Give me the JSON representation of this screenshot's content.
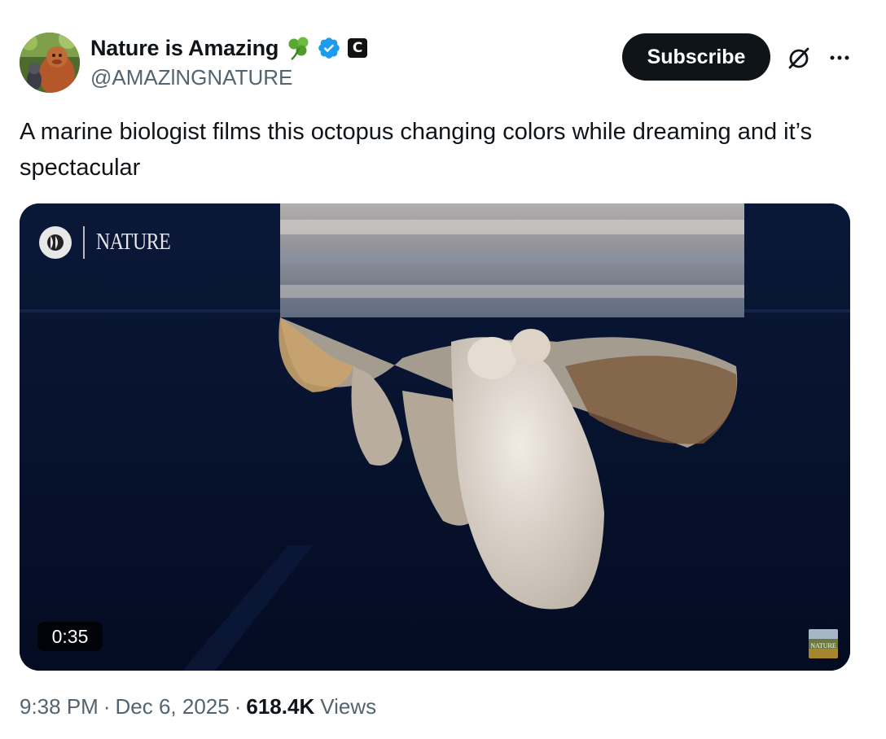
{
  "author": {
    "display_name": "Nature is Amazing",
    "handle": "@AMAZlNGNATURE",
    "emoji_icon": "shamrock-icon",
    "verified_color": "#1d9bf0",
    "badge_letter": "C"
  },
  "actions": {
    "subscribe_label": "Subscribe",
    "grok_icon": "grok-icon",
    "more_icon": "more-options-icon"
  },
  "tweet": {
    "text": "A marine biologist films this octopus changing colors while dreaming and it’s spectacular"
  },
  "media": {
    "watermark_text": "NATURE",
    "duration": "0:35",
    "thumb_text": "NATURE"
  },
  "meta": {
    "time": "9:38 PM",
    "date": "Dec 6, 2025",
    "separator": "·",
    "views_count": "618.4K",
    "views_label": "Views"
  },
  "colors": {
    "accent": "#1d9bf0",
    "text_primary": "#0f1419",
    "text_secondary": "#536471",
    "button_bg": "#0f1419"
  }
}
